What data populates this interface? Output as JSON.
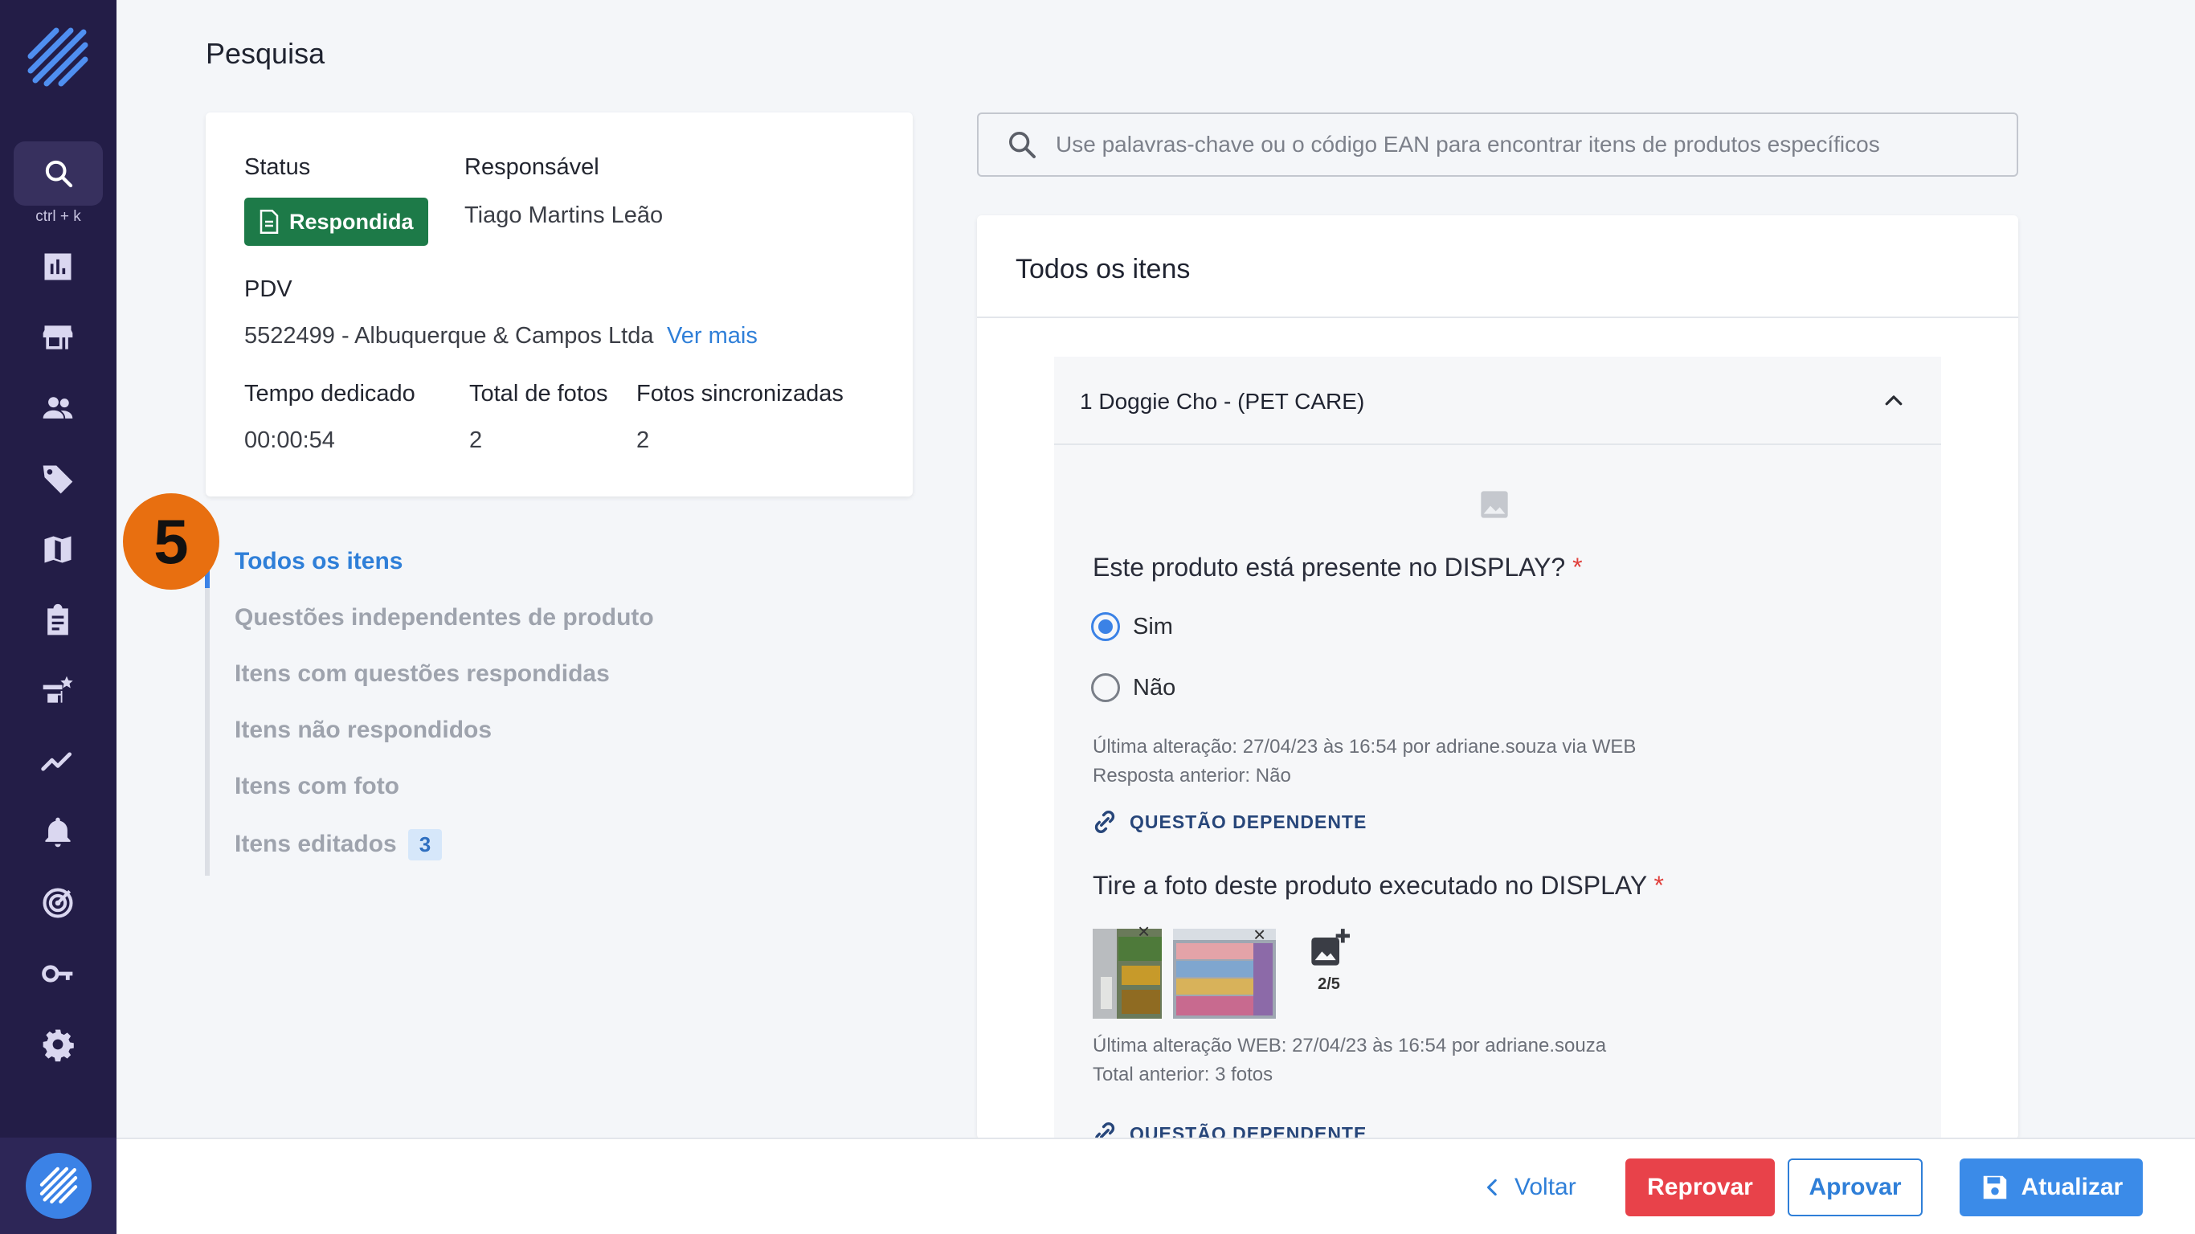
{
  "sidebar": {
    "shortcut": "ctrl + k"
  },
  "page": {
    "title": "Pesquisa"
  },
  "status_card": {
    "status_label": "Status",
    "status_value": "Respondida",
    "responsible_label": "Responsável",
    "responsible_value": "Tiago Martins Leão",
    "pdv_label": "PDV",
    "pdv_value": "5522499 - Albuquerque & Campos Ltda",
    "ver_mais": "Ver mais",
    "time_label": "Tempo dedicado",
    "time_value": "00:00:54",
    "photos_label": "Total de fotos",
    "photos_value": "2",
    "synced_label": "Fotos sincronizadas",
    "synced_value": "2"
  },
  "step_marker": "5",
  "filters": [
    {
      "label": "Todos os itens",
      "active": true
    },
    {
      "label": "Questões independentes de produto"
    },
    {
      "label": "Itens com questões respondidas"
    },
    {
      "label": "Itens não respondidos"
    },
    {
      "label": "Itens com foto"
    },
    {
      "label": "Itens editados",
      "count": "3"
    }
  ],
  "search": {
    "placeholder": "Use palavras-chave ou o código EAN para encontrar itens de produtos específicos"
  },
  "items": {
    "title": "Todos os itens",
    "product_name": "1 Doggie Cho - (PET CARE)",
    "q1": {
      "text": "Este produto está presente no DISPLAY?",
      "required_mark": "*",
      "options": [
        "Sim",
        "Não"
      ],
      "selected": "Sim",
      "meta_line1": "Última alteração: 27/04/23 às 16:54 por adriane.souza via WEB",
      "meta_line2": "Resposta anterior:  Não",
      "dependent_label": "QUESTÃO DEPENDENTE"
    },
    "q2": {
      "text": "Tire a foto deste produto executado no DISPLAY",
      "required_mark": "*",
      "photo_count": "2/5",
      "meta_line1": "Última alteração WEB: 27/04/23 às 16:54 por adriane.souza",
      "meta_line2": "Total anterior: 3 fotos",
      "dependent_label": "QUESTÃO DEPENDENTE"
    }
  },
  "footer": {
    "back": "Voltar",
    "reject": "Reprovar",
    "approve": "Aprovar",
    "update": "Atualizar"
  },
  "colors": {
    "sidebar": "#231d47",
    "accent": "#3b82e6",
    "status_badge": "#1d7a48",
    "reject": "#e8424a",
    "step_marker": "#e86f10"
  }
}
